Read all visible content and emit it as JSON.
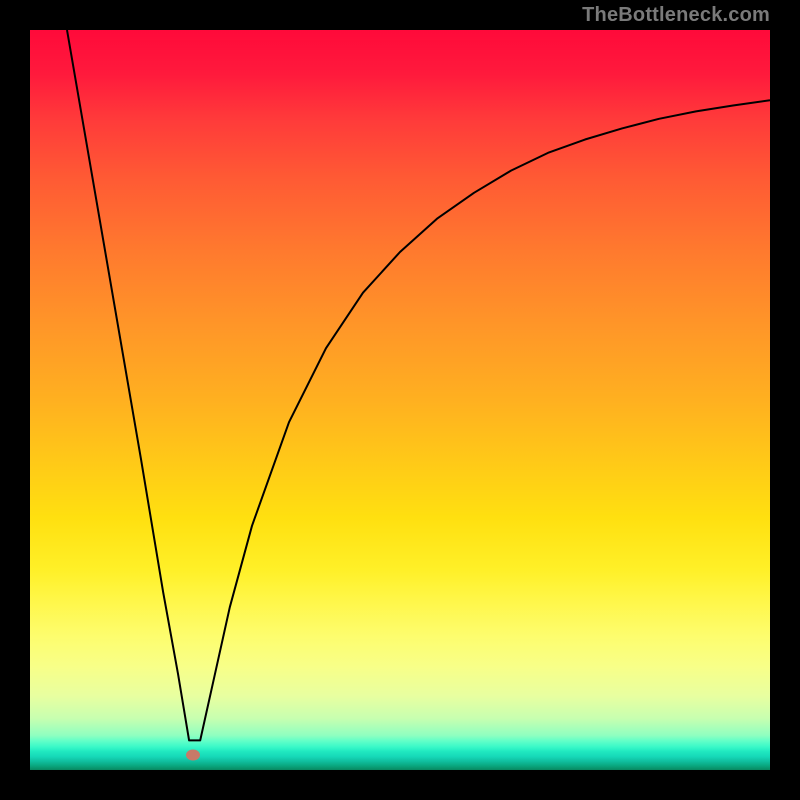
{
  "attribution_text": "TheBottleneck.com",
  "marker_color": "#c77a68",
  "chart_data": {
    "type": "line",
    "title": "",
    "xlabel": "",
    "ylabel": "",
    "xlim": [
      0,
      100
    ],
    "ylim": [
      0,
      100
    ],
    "annotations": [
      "TheBottleneck.com"
    ],
    "marker": {
      "x": 22,
      "y": 2
    },
    "series": [
      {
        "name": "curve",
        "x": [
          5,
          10,
          15,
          18,
          20,
          21.5,
          23,
          25,
          27,
          30,
          35,
          40,
          45,
          50,
          55,
          60,
          65,
          70,
          75,
          80,
          85,
          90,
          95,
          100
        ],
        "y": [
          100,
          71,
          42,
          24,
          13,
          4,
          4,
          13,
          22,
          33,
          47,
          57,
          64.5,
          70,
          74.5,
          78,
          81,
          83.4,
          85.2,
          86.7,
          88,
          89,
          89.8,
          90.5
        ]
      }
    ]
  }
}
